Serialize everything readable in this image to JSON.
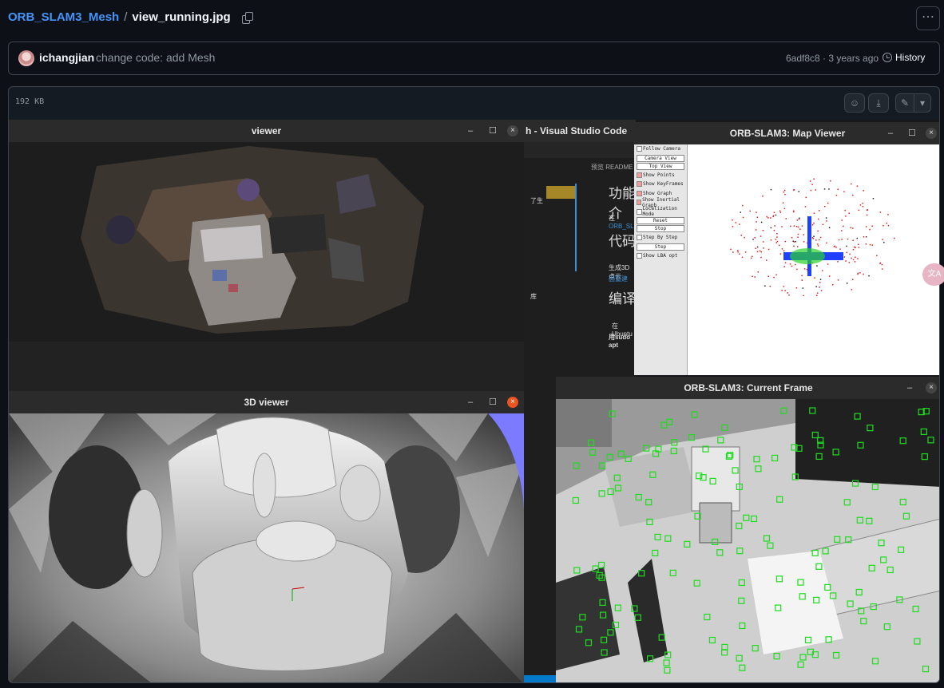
{
  "breadcrumb": {
    "repo": "ORB_SLAM3_Mesh",
    "separator": "/",
    "file": "view_running.jpg"
  },
  "commit": {
    "author": "ichangjian",
    "message": "change code: add Mesh",
    "sha_age": "6adf8c8 · 3 years ago",
    "history_label": "History"
  },
  "file_header": {
    "size": "192 KB"
  },
  "screenshot": {
    "viewer_title": "viewer",
    "vscode_title": "h - Visual Studio Code",
    "map_viewer_title": "ORB-SLAM3: Map Viewer",
    "viewer3d_title": "3D viewer",
    "current_frame_title": "ORB-SLAM3: Current Frame",
    "vscode": {
      "tab": "预览 README",
      "h1": "功能介",
      "p1_a": "在",
      "p1_b": "ORB_SL",
      "h2": "代码",
      "p2": "生成3D点云",
      "p2_link": "面重建",
      "h3": "编译",
      "p3": "在Ubuntu",
      "p4": "用sudo apt",
      "left1": "了生",
      "left2": "库"
    },
    "map_viewer_panel": [
      "Follow Camera",
      "Camera View",
      "Top View",
      "Show Points",
      "Show KeyFrames",
      "Show Graph",
      "Show Inertial Graph",
      "Localization Mode",
      "Reset",
      "Stop",
      "Step By Step",
      "Step",
      "Show LBA opt"
    ]
  },
  "colors": {
    "link": "#4493f8",
    "close_active": "#e95420",
    "feature": "#1fdc1f",
    "map_points": "#e02020",
    "keyframes": "#2040ff"
  }
}
